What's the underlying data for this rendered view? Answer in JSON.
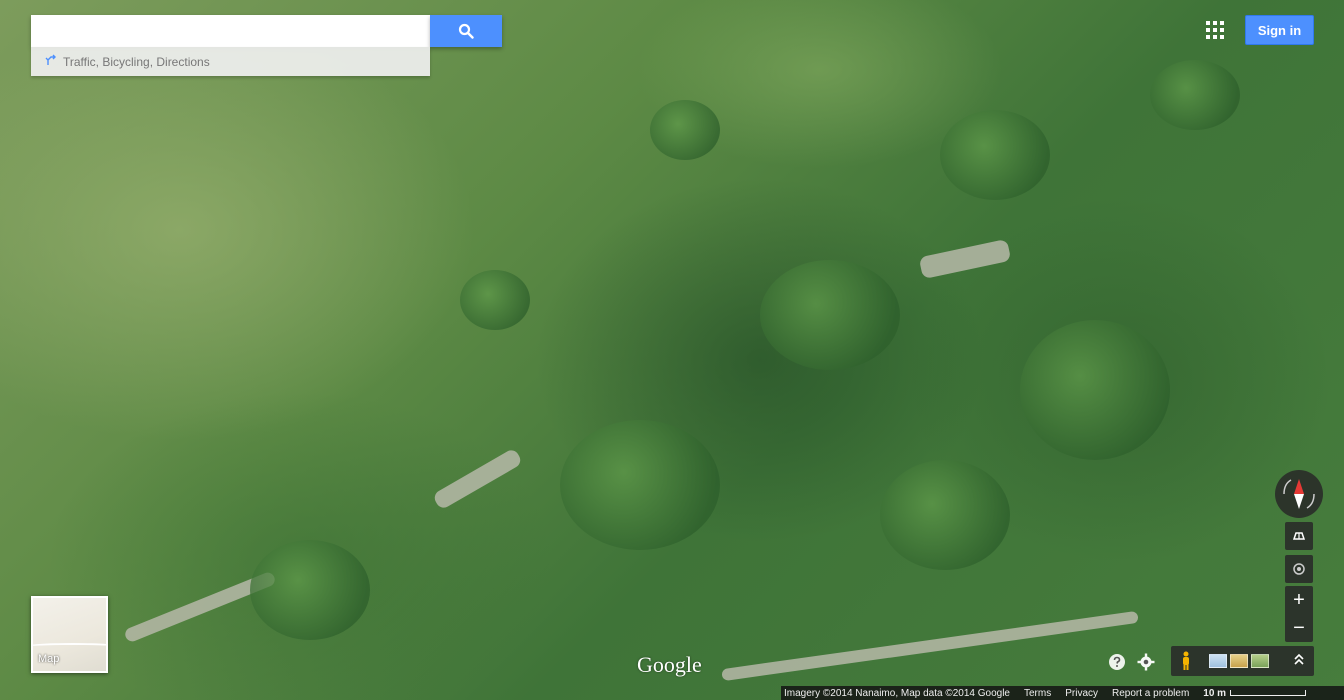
{
  "search": {
    "value": "",
    "placeholder": "",
    "suggest_text": "Traffic, Bicycling, Directions"
  },
  "header": {
    "sign_in_label": "Sign in"
  },
  "map_thumbnail": {
    "label": "Map"
  },
  "logo": {
    "text": "Google"
  },
  "controls": {
    "zoom_in": "+",
    "zoom_out": "−"
  },
  "footer": {
    "attribution": "Imagery ©2014 Nanaimo, Map data ©2014 Google",
    "terms": "Terms",
    "privacy": "Privacy",
    "report": "Report a problem",
    "scale": "10 m"
  },
  "colors": {
    "accent_blue": "#4d90fe",
    "control_bg": "#282828",
    "compass_red": "#e53935"
  },
  "icons": {
    "search": "search-icon",
    "apps": "apps-grid-icon",
    "route": "route-icon",
    "compass": "compass-icon",
    "tilt": "tilt-icon",
    "locate": "my-location-icon",
    "pegman": "pegman-icon",
    "help": "help-icon",
    "settings": "gear-icon",
    "expand": "chevron-up-icon"
  }
}
